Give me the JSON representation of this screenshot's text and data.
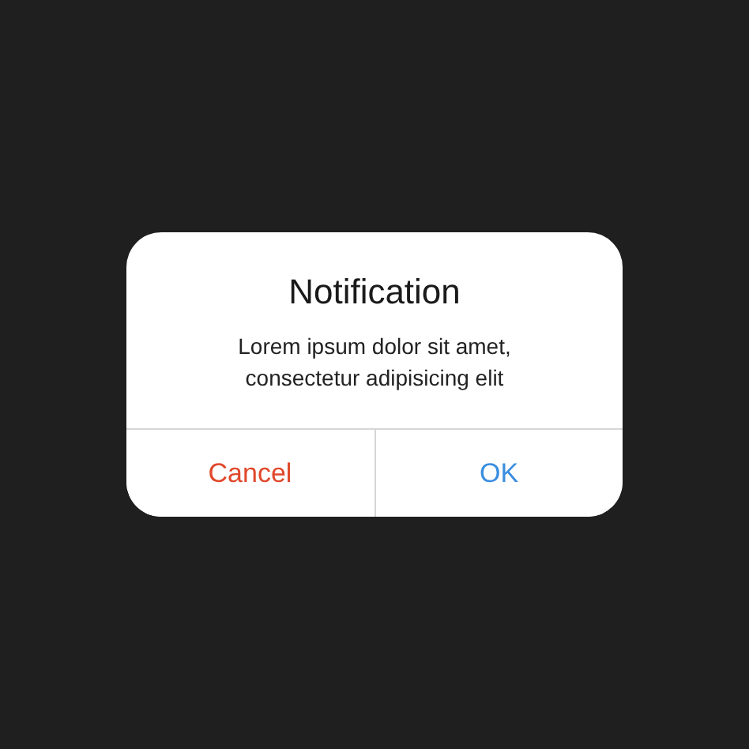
{
  "dialog": {
    "title": "Notification",
    "message": "Lorem ipsum dolor sit amet, consectetur adipisicing elit",
    "buttons": [
      {
        "label": "Cancel",
        "kind": "cancel"
      },
      {
        "label": "OK",
        "kind": "confirm"
      }
    ]
  }
}
